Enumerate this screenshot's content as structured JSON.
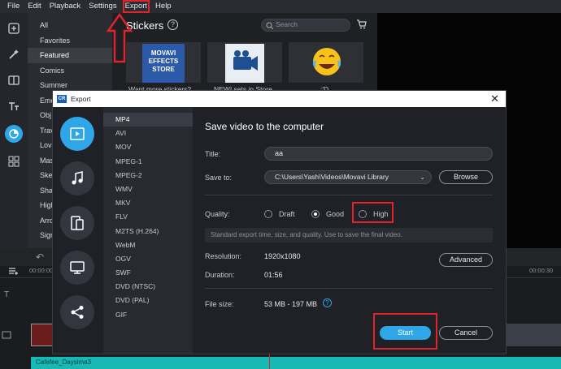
{
  "menu": [
    "File",
    "Edit",
    "Playback",
    "Settings",
    "Export",
    "Help"
  ],
  "categories": [
    "All",
    "Favorites",
    "Featured",
    "Comics",
    "Summer",
    "Emo",
    "Obj",
    "Trav",
    "Lov",
    "Mas",
    "Ske",
    "Sha",
    "High",
    "Arro",
    "Sign"
  ],
  "stickers": {
    "title": "Stickers",
    "search_placeholder": "Search",
    "tiles": [
      {
        "caption": "Want more stickers?",
        "art": "MOVAVI EFFECTS STORE"
      },
      {
        "caption": "NEW! sets in Store"
      },
      {
        "caption": ":'D"
      }
    ]
  },
  "dialog": {
    "title": "Export",
    "formats": [
      "MP4",
      "AVI",
      "MOV",
      "MPEG-1",
      "MPEG-2",
      "WMV",
      "MKV",
      "FLV",
      "M2TS (H.264)",
      "WebM",
      "OGV",
      "SWF",
      "DVD (NTSC)",
      "DVD (PAL)",
      "GIF"
    ],
    "heading": "Save video to the computer",
    "title_label": "Title:",
    "title_value": "aa",
    "save_to_label": "Save to:",
    "save_to_value": "C:\\Users\\Yash\\Videos\\Movavi Library",
    "browse": "Browse",
    "quality_label": "Quality:",
    "quality_options": [
      "Draft",
      "Good",
      "High"
    ],
    "quality_selected": "Good",
    "quality_hint": "Standard export time, size, and quality. Use to save the final video.",
    "resolution_label": "Resolution:",
    "resolution_value": "1920x1080",
    "advanced": "Advanced",
    "duration_label": "Duration:",
    "duration_value": "01:56",
    "filesize_label": "File size:",
    "filesize_value": "53 MB - 197 MB",
    "start": "Start",
    "cancel": "Cancel"
  },
  "timeline": {
    "time_start": "00:00:00",
    "time_end": "00:00:30",
    "audio_track": "Cafefee_Daysima3"
  },
  "colors": {
    "accent": "#2fa6e8",
    "highlight": "#e0242b",
    "audio": "#18b9b4"
  }
}
